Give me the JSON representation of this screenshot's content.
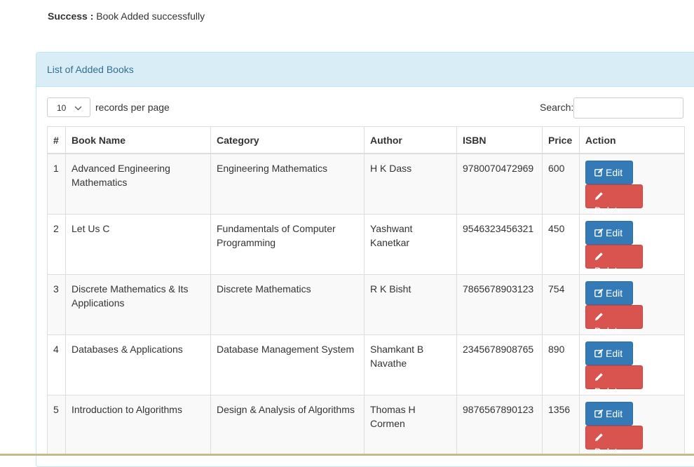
{
  "alert": {
    "label": "Success :",
    "message": "Book Added successfully"
  },
  "panel": {
    "title": "List of Added Books"
  },
  "controls": {
    "page_length": "10",
    "page_length_suffix": "records per page",
    "search_label": "Search:",
    "search_value": ""
  },
  "table": {
    "headers": {
      "num": "#",
      "name": "Book Name",
      "category": "Category",
      "author": "Author",
      "isbn": "ISBN",
      "price": "Price",
      "action": "Action"
    },
    "rows": [
      {
        "num": "1",
        "name": "Advanced Engineering Mathematics",
        "category": "Engineering Mathematics",
        "author": "H K Dass",
        "isbn": "9780070472969",
        "price": "600"
      },
      {
        "num": "2",
        "name": "Let Us C",
        "category": "Fundamentals of Computer Programming",
        "author": "Yashwant Kanetkar",
        "isbn": "9546323456321",
        "price": "450"
      },
      {
        "num": "3",
        "name": "Discrete Mathematics & Its Applications",
        "category": "Discrete Mathematics",
        "author": "R K Bisht",
        "isbn": "7865678903123",
        "price": "754"
      },
      {
        "num": "4",
        "name": "Databases & Applications",
        "category": "Database Management System",
        "author": "Shamkant B Navathe",
        "isbn": "2345678908765",
        "price": "890"
      },
      {
        "num": "5",
        "name": "Introduction to Algorithms",
        "category": "Design & Analysis of Algorithms",
        "author": "Thomas H Cormen",
        "isbn": "9876567890123",
        "price": "1356"
      }
    ],
    "edit_label": "Edit",
    "delete_label": "Delete"
  },
  "icons": {
    "edit": "edit-icon",
    "delete": "pencil-icon",
    "dropdown": "chevron-down-icon"
  },
  "colors": {
    "panel_heading_bg": "#d9edf7",
    "panel_heading_text": "#31708f",
    "edit_button": "#337ab7",
    "delete_button": "#d9534f"
  }
}
